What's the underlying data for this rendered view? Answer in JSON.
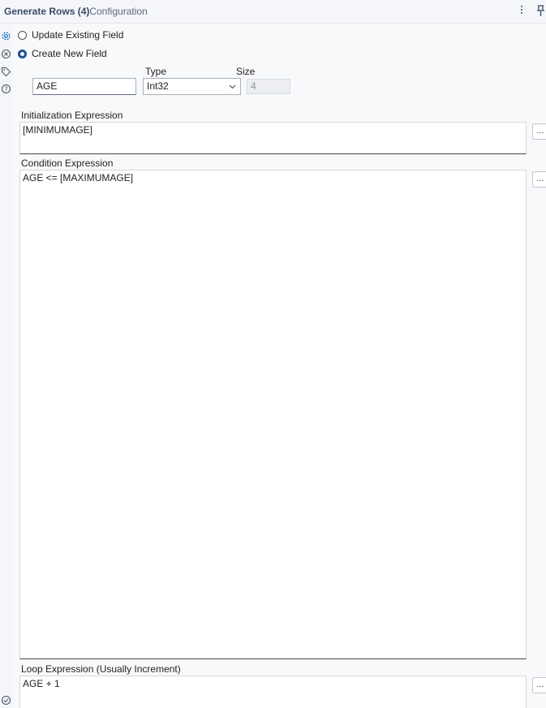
{
  "window": {
    "title": "Generate Rows (4)",
    "subtitle": "- Configuration"
  },
  "rail": {
    "icons": [
      "gear-icon",
      "settings-alt-icon",
      "tag-icon",
      "help-icon",
      "check-icon"
    ]
  },
  "mode": {
    "option_update": "Update Existing Field",
    "option_create": "Create New  Field",
    "selected": "Create New  Field"
  },
  "new_field": {
    "name_value": "AGE",
    "type_label": "Type",
    "type_value": "Int32",
    "size_label": "Size",
    "size_value": "4"
  },
  "init_expr": {
    "label": "Initialization Expression",
    "value": "[MINIMUMAGE]",
    "button": "..."
  },
  "cond_expr": {
    "label": "Condition Expression",
    "value": "AGE <= [MAXIMUMAGE]",
    "button": "..."
  },
  "loop_expr": {
    "label": "Loop Expression (Usually Increment)",
    "value": "AGE + 1",
    "button": "..."
  },
  "colors": {
    "accent": "#1a4f9c",
    "title_text": "#3b4a66",
    "panel_bg": "#f8f9fb"
  }
}
